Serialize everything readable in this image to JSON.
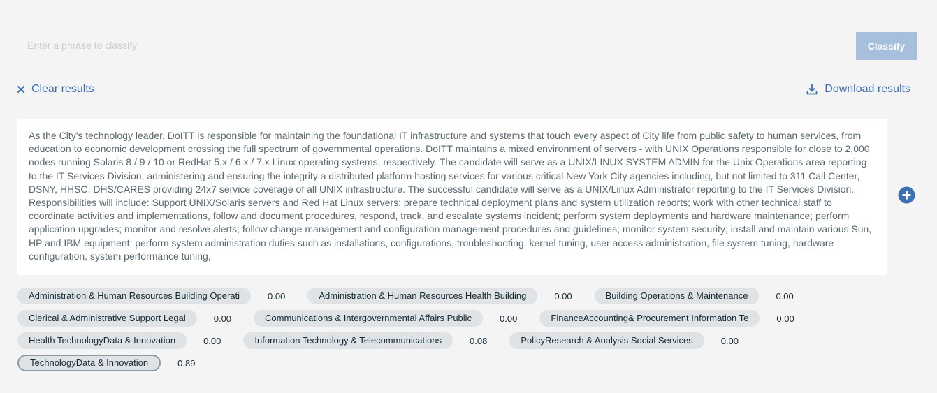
{
  "classify": {
    "placeholder": "Enter a phrase to classify",
    "value": "",
    "button_label": "Classify"
  },
  "actions": {
    "clear_label": "Clear results",
    "download_label": "Download results",
    "clear_icon": "close-icon",
    "download_icon": "download-icon",
    "add_icon": "add-filled-icon"
  },
  "document": {
    "text": "As the City's technology leader, DoITT is responsible for maintaining the foundational IT infrastructure and systems that touch every aspect of City life from public safety to human services, from education to economic development crossing the full spectrum of governmental operations. DoITT maintains a mixed environment of servers - with UNIX Operations responsible for close to 2,000 nodes running Solaris 8 / 9 / 10 or RedHat 5.x / 6.x / 7.x Linux operating systems, respectively. The candidate will serve as a UNIX/LINUX SYSTEM ADMIN for the Unix Operations area reporting to the IT Services Division, administering and ensuring the integrity a distributed platform hosting services for various critical New York City agencies including, but not limited to 311 Call Center, DSNY, HHSC, DHS/CARES providing 24x7 service coverage of all UNIX infrastructure. The successful candidate will serve as a UNIX/Linux Administrator reporting to the IT Services Division. Responsibilities will include: Support UNIX/Solaris servers and Red Hat Linux servers; prepare technical deployment plans and system utilization reports; work with other technical staff to coordinate activities and implementations, follow and document procedures, respond, track, and escalate systems incident; perform system deployments and hardware maintenance; perform application upgrades; monitor and resolve alerts; follow change management and configuration management procedures and guidelines; monitor system security; install and maintain various Sun, HP and IBM equipment; perform system administration duties such as installations, configurations, troubleshooting, kernel tuning, user access administration, file system tuning, hardware configuration, system performance tuning,"
  },
  "results": [
    [
      {
        "label": "Administration & Human Resources Building Operati",
        "score": "0.00"
      },
      {
        "label": "Administration & Human Resources Health Building",
        "score": "0.00"
      },
      {
        "label": "Building Operations & Maintenance",
        "score": "0.00"
      }
    ],
    [
      {
        "label": "Clerical & Administrative Support Legal",
        "score": "0.00"
      },
      {
        "label": "Communications & Intergovernmental Affairs Public",
        "score": "0.00"
      },
      {
        "label": "FinanceAccounting& Procurement Information Te",
        "score": "0.00"
      }
    ],
    [
      {
        "label": "Health TechnologyData & Innovation",
        "score": "0.00"
      },
      {
        "label": "Information Technology & Telecommunications",
        "score": "0.08"
      },
      {
        "label": "PolicyResearch & Analysis Social Services",
        "score": "0.00"
      }
    ],
    [
      {
        "label": "TechnologyData & Innovation",
        "score": "0.89",
        "selected": true
      }
    ]
  ],
  "colors": {
    "background": "#f4f4f4",
    "accent": "#3d70b2",
    "button_disabled": "#a6bfdd",
    "tag_background": "#dfe3e6"
  }
}
